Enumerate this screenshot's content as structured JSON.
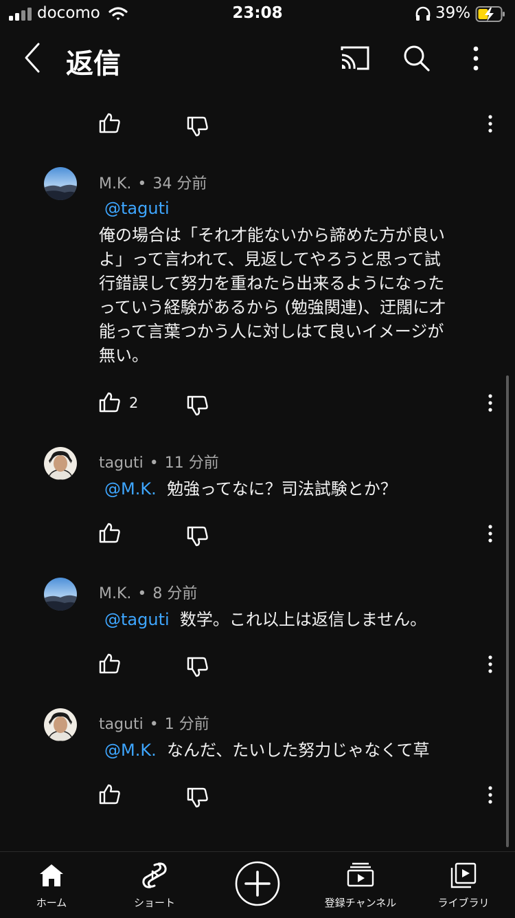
{
  "status_bar": {
    "carrier": "docomo",
    "time": "23:08",
    "battery": "39%"
  },
  "header": {
    "title": "返信",
    "icons": [
      "back-arrow-icon",
      "cast-icon",
      "search-icon",
      "more-vert-icon"
    ]
  },
  "comments": [
    {
      "author": "M.K.",
      "time_ago": "34 分前",
      "mention": "@taguti",
      "lines": [
        "俺の場合は「それ才能ないから諦めた方が良い",
        "よ」って言われて、見返してやろうと思って試",
        "行錯誤して努力を重ねたら出来るようになった",
        "っていう経験があるから (勉強関連)、迂闊に才",
        "能って言葉つかう人に対しはて良いイメージが",
        "無い。"
      ],
      "likes": "2"
    },
    {
      "author": "taguti",
      "time_ago": "11 分前",
      "mention": "@M.K.",
      "text": "勉強ってなに？司法試験とか？"
    },
    {
      "author": "M.K.",
      "time_ago": "8 分前",
      "mention": "@taguti",
      "text": "数学。これ以上は返信しません。"
    },
    {
      "author": "taguti",
      "time_ago": "1 分前",
      "mention": "@M.K.",
      "text": "なんだ、たいした努力じゃなくて草"
    }
  ],
  "bottom_nav": [
    {
      "label": "ホーム",
      "icon": "home-icon"
    },
    {
      "label": "ショート",
      "icon": "shorts-icon"
    },
    {
      "label": "",
      "icon": "create-plus-icon"
    },
    {
      "label": "登録チャンネル",
      "icon": "subscriptions-icon"
    },
    {
      "label": "ライブラリ",
      "icon": "library-icon"
    }
  ],
  "colors": {
    "background": "#0f0f0f",
    "mention": "#3ea6ff",
    "meta": "#aaaaaa",
    "text": "#f1f1f1"
  }
}
